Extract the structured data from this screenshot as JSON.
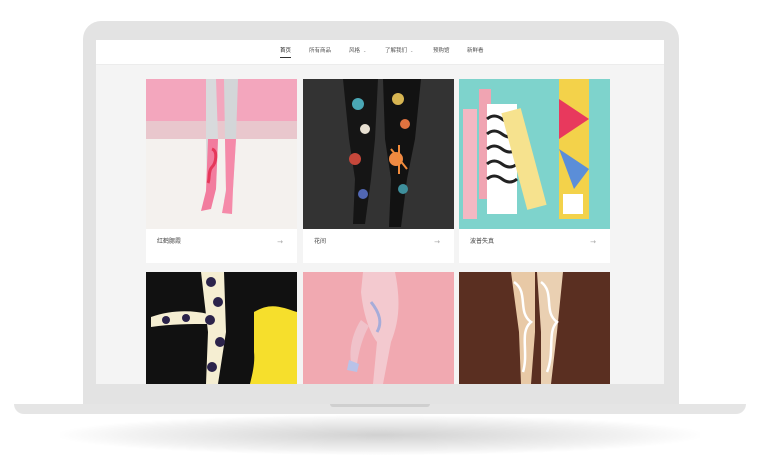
{
  "nav": {
    "items": [
      {
        "label": "首页",
        "active": true
      },
      {
        "label": "所有商品",
        "active": false
      },
      {
        "label": "风格",
        "has_dropdown": true
      },
      {
        "label": "了解我们",
        "has_dropdown": true
      },
      {
        "label": "预购馆",
        "active": false
      },
      {
        "label": "新鲜看",
        "active": false
      }
    ],
    "dropdown_icon": "chevron-down-icon"
  },
  "products": [
    {
      "title": "红鹤腮霞",
      "arrow": "→"
    },
    {
      "title": "花间",
      "arrow": "→"
    },
    {
      "title": "波普失真",
      "arrow": "→"
    },
    {
      "title": ""
    },
    {
      "title": ""
    },
    {
      "title": ""
    }
  ],
  "colors": {
    "flamingo_bg": "#f3a6bd",
    "floral_bg": "#3a3a3a",
    "pop_bg": "#7ed3cc",
    "dots_bg": "#111111",
    "pink_bg": "#f1a9b1",
    "brown_bg": "#5a2f21"
  }
}
